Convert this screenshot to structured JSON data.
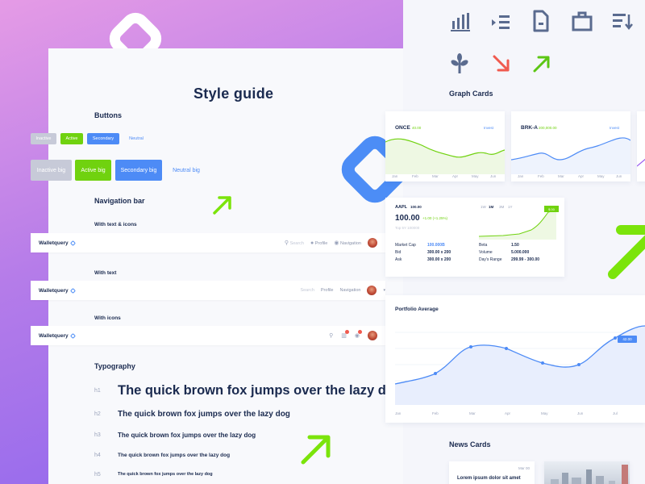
{
  "title": "Style guide",
  "sections": {
    "buttons": "Buttons",
    "navigation": "Navigation bar",
    "typography": "Typography",
    "graph_cards": "Graph Cards",
    "news_cards": "News Cards"
  },
  "buttons": {
    "small": [
      "Inactive",
      "Active",
      "Secondary",
      "Neutral"
    ],
    "big": [
      "Inactive big",
      "Active big",
      "Secondary big",
      "Neutral big"
    ]
  },
  "nav": {
    "sub_text_icons": "With text & icons",
    "sub_text": "With text",
    "sub_icons": "With icons",
    "brand": "Walletquery",
    "search": "Search",
    "profile": "Profile",
    "navigation": "Navigation",
    "badge_count": "2"
  },
  "typography": {
    "tags": [
      "h1",
      "h2",
      "h3",
      "h4",
      "h5"
    ],
    "samples": [
      "The quick brown fox jumps over the lazy dog",
      "The quick brown fox jumps over the lazy dog",
      "The quick brown fox jumps over the lazy dog",
      "The quick brown fox jumps over the lazy dog",
      "The quick brown fox jumps over the lazy dog"
    ]
  },
  "top_icons": [
    "bar-chart-icon",
    "list-icon",
    "document-icon",
    "briefcase-icon",
    "sort-icon",
    "plant-icon",
    "arrow-down-right-icon",
    "arrow-up-right-icon"
  ],
  "graph_cards": [
    {
      "ticker": "ONCE",
      "change": "40.00",
      "action": "Invest",
      "color": "#70d20f",
      "months": [
        "Jan",
        "Feb",
        "Mar",
        "Apr",
        "May",
        "Jun"
      ]
    },
    {
      "ticker": "BRK-A",
      "change": "200,000.00",
      "action": "Invest",
      "color": "#4d8bf6",
      "months": [
        "Jan",
        "Feb",
        "Mar",
        "Apr",
        "May",
        "Jun"
      ]
    }
  ],
  "stock_card": {
    "ticker": "AAPL",
    "price_small": "100.00",
    "price": "100.00",
    "change": "+1.00 (+1.25%)",
    "sub": "Top 5Y 100000",
    "ranges": [
      "1W",
      "1M",
      "3M",
      "1Y"
    ],
    "tooltip": "$ 00",
    "rows_left": [
      {
        "label": "Market Cap",
        "value": "100.000B"
      },
      {
        "label": "Bid",
        "value": "300.00 x 200"
      },
      {
        "label": "Ask",
        "value": "300.00 x 200"
      }
    ],
    "rows_right": [
      {
        "label": "Beta",
        "value": "1.50"
      },
      {
        "label": "Volume",
        "value": "5.000.000"
      },
      {
        "label": "Day's Range",
        "value": "299.99 - 300.00"
      }
    ]
  },
  "portfolio": {
    "title": "Portfolio Average",
    "tooltip": "42.00",
    "months": [
      "Jan",
      "Feb",
      "Mar",
      "Apr",
      "May",
      "Jun",
      "Jul"
    ]
  },
  "news": {
    "headline": "Lorem ipsum dolor sit amet",
    "meta": "Mar 00"
  },
  "colors": {
    "accent_green": "#70d20f",
    "accent_blue": "#4d8bf6",
    "navy": "#1a2a4f",
    "down_red": "#f05a4f"
  }
}
